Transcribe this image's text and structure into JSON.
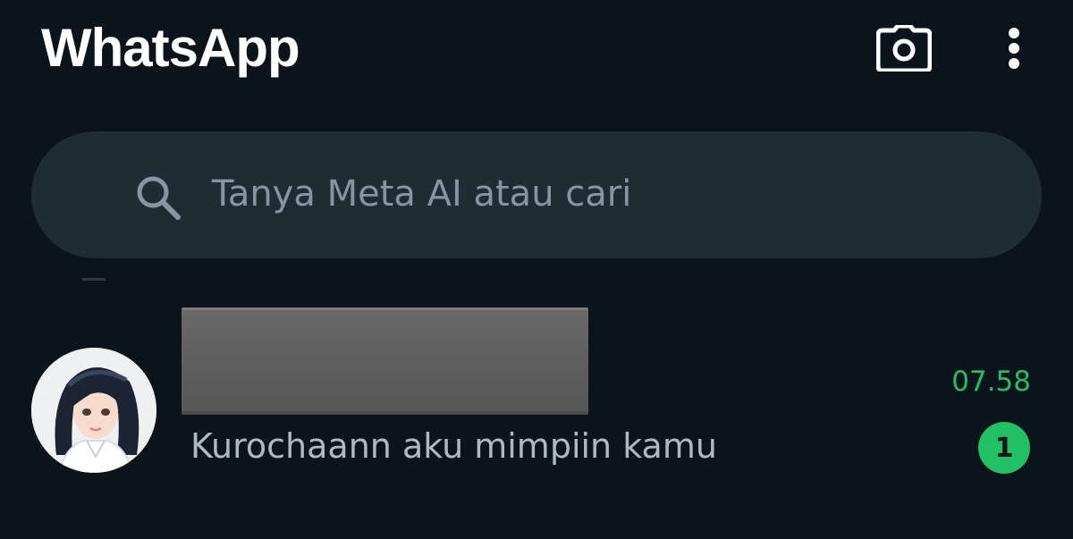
{
  "header": {
    "title": "WhatsApp",
    "icons": [
      "camera-icon",
      "more-vert-icon"
    ]
  },
  "search": {
    "placeholder": "Tanya Meta AI atau cari",
    "icon": "search-icon"
  },
  "chats": [
    {
      "name_redacted": true,
      "preview": "Kurochaann aku mimpiin kamu",
      "time": "07.58",
      "unread_count": "1"
    }
  ],
  "colors": {
    "background": "#0b141a",
    "search_bg": "#202c33",
    "accent_green": "#21c063",
    "muted_text": "#8696a0",
    "preview_text": "#aebac1"
  }
}
